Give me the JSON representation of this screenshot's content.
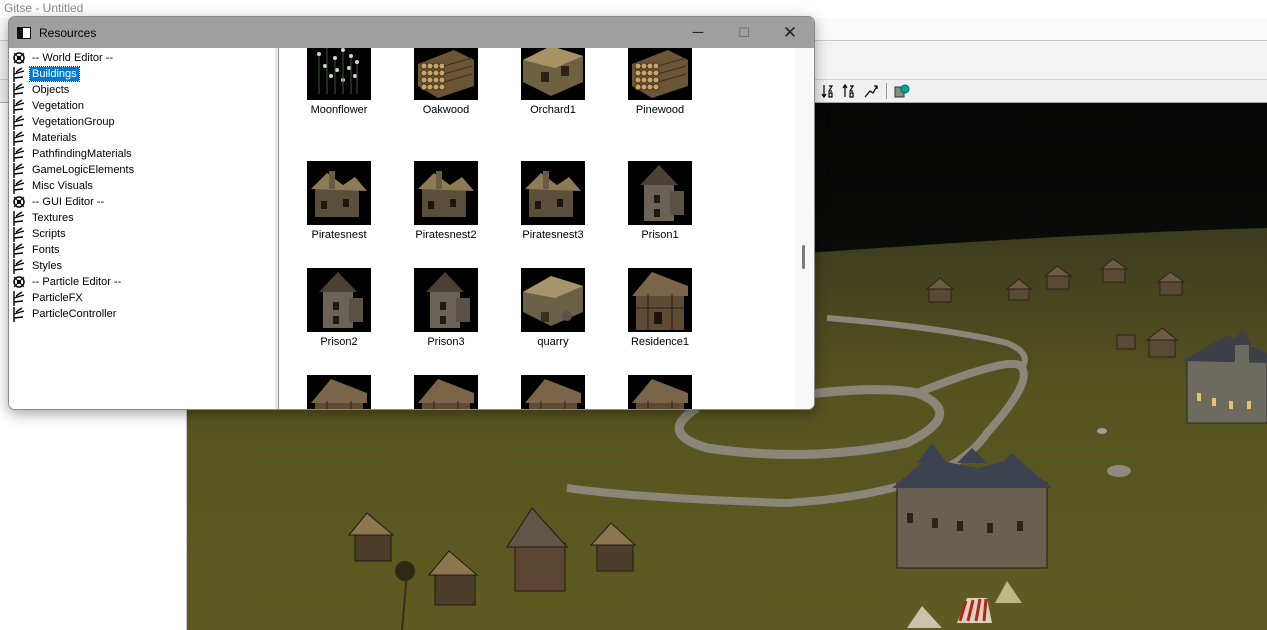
{
  "app": {
    "title": "Gitse - Untitled"
  },
  "resources_window": {
    "title": "Resources",
    "tree": [
      {
        "label": "-- World Editor --",
        "kind": "section"
      },
      {
        "label": "Buildings",
        "kind": "item",
        "selected": true
      },
      {
        "label": "Objects",
        "kind": "item"
      },
      {
        "label": "Vegetation",
        "kind": "item"
      },
      {
        "label": "VegetationGroup",
        "kind": "item"
      },
      {
        "label": "Materials",
        "kind": "item"
      },
      {
        "label": "PathfindingMaterials",
        "kind": "item"
      },
      {
        "label": "GameLogicElements",
        "kind": "item"
      },
      {
        "label": "Misc Visuals",
        "kind": "item"
      },
      {
        "label": "-- GUI Editor --",
        "kind": "section"
      },
      {
        "label": "Textures",
        "kind": "item"
      },
      {
        "label": "Scripts",
        "kind": "item"
      },
      {
        "label": "Fonts",
        "kind": "item"
      },
      {
        "label": "Styles",
        "kind": "item"
      },
      {
        "label": "-- Particle Editor --",
        "kind": "section"
      },
      {
        "label": "ParticleFX",
        "kind": "item"
      },
      {
        "label": "ParticleController",
        "kind": "item"
      }
    ],
    "thumbnails": [
      {
        "label": "Moonflower",
        "icon": "moonflower-thumbnail"
      },
      {
        "label": "Oakwood",
        "icon": "log-pile-thumbnail"
      },
      {
        "label": "Orchard1",
        "icon": "orchard-thumbnail"
      },
      {
        "label": "Pinewood",
        "icon": "log-pile-thumbnail"
      },
      {
        "label": "Piratesnest",
        "icon": "pirates-nest-thumbnail"
      },
      {
        "label": "Piratesnest2",
        "icon": "pirates-nest-thumbnail"
      },
      {
        "label": "Piratesnest3",
        "icon": "pirates-nest-thumbnail"
      },
      {
        "label": "Prison1",
        "icon": "prison-tower-thumbnail"
      },
      {
        "label": "Prison2",
        "icon": "prison-tower-thumbnail"
      },
      {
        "label": "Prison3",
        "icon": "prison-tower-thumbnail"
      },
      {
        "label": "quarry",
        "icon": "quarry-thumbnail"
      },
      {
        "label": "Residence1",
        "icon": "residence-thumbnail"
      },
      {
        "label": "",
        "icon": "residence-thumbnail"
      },
      {
        "label": "",
        "icon": "residence-thumbnail"
      },
      {
        "label": "",
        "icon": "residence-thumbnail"
      },
      {
        "label": "",
        "icon": "residence-thumbnail"
      }
    ]
  },
  "toolbar": {
    "icons": [
      "sort-descending-icon",
      "sort-ascending-icon",
      "path-tool-icon",
      "layer-color-icon"
    ]
  },
  "colors": {
    "selection": "#0078d7",
    "window_titlebar": "#9f9f9f",
    "terrain": "#5b5a22"
  }
}
